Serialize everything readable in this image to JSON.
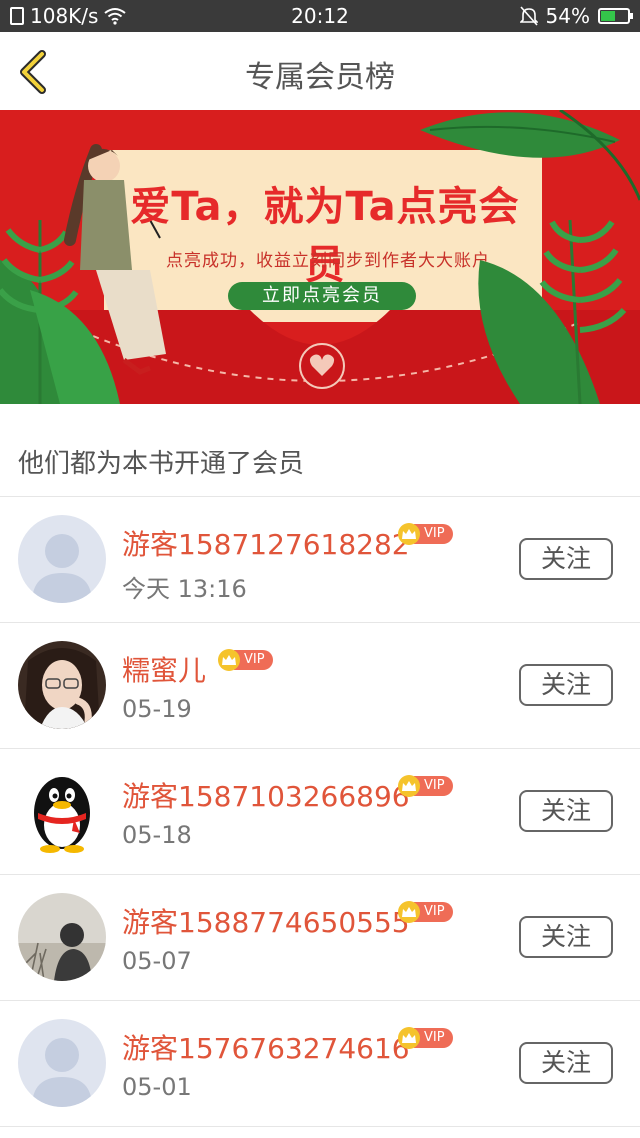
{
  "status_bar": {
    "speed": "108K/s",
    "time": "20:12",
    "battery": "54%",
    "battery_level": 0.54
  },
  "nav": {
    "title": "专属会员榜"
  },
  "banner": {
    "title": "爱Ta，就为Ta点亮会员",
    "subtitle": "点亮成功，收益立刻同步到作者大大账户",
    "button": "立即点亮会员"
  },
  "section": {
    "title": "他们都为本书开通了会员"
  },
  "members": [
    {
      "name": "游客1587127618282",
      "date": "今天 13:16",
      "avatar": "default-avatar",
      "vip": "VIP",
      "follow": "关注"
    },
    {
      "name": "糯蜜儿",
      "date": "05-19",
      "avatar": "photo-girl-avatar",
      "vip": "VIP",
      "follow": "关注"
    },
    {
      "name": "游客1587103266896",
      "date": "05-18",
      "avatar": "qq-penguin-avatar",
      "vip": "VIP",
      "follow": "关注"
    },
    {
      "name": "游客1588774650555",
      "date": "05-07",
      "avatar": "photo-silhouette-avatar",
      "vip": "VIP",
      "follow": "关注"
    },
    {
      "name": "游客1576763274616",
      "date": "05-01",
      "avatar": "default-avatar",
      "vip": "VIP",
      "follow": "关注"
    }
  ],
  "colors": {
    "accent": "#e0553a",
    "banner_red": "#d81e1e",
    "vip_gold": "#f5c32c",
    "vip_tag": "#ef6c56"
  }
}
